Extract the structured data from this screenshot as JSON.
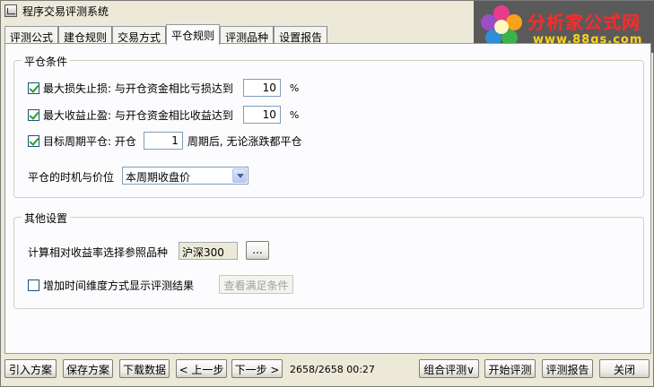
{
  "window": {
    "title": "程序交易评测系统"
  },
  "logo": {
    "title": "分析家公式网",
    "url": "www.88gs.com"
  },
  "tabs": [
    {
      "label": "评测公式",
      "active": false
    },
    {
      "label": "建仓规则",
      "active": false
    },
    {
      "label": "交易方式",
      "active": false
    },
    {
      "label": "平仓规则",
      "active": true
    },
    {
      "label": "评测品种",
      "active": false
    },
    {
      "label": "设置报告",
      "active": false
    }
  ],
  "close_conditions": {
    "legend": "平仓条件",
    "stop_loss": {
      "checked": true,
      "label": "最大损失止损: 与开仓资金相比亏损达到",
      "value": "10",
      "unit": "%"
    },
    "take_profit": {
      "checked": true,
      "label": "最大收益止盈: 与开仓资金相比收益达到",
      "value": "10",
      "unit": "%"
    },
    "target_period": {
      "checked": true,
      "label_before": "目标周期平仓: 开仓",
      "value": "1",
      "label_after": "周期后, 无论涨跌都平仓"
    },
    "timing": {
      "label": "平仓的时机与价位",
      "selected": "本周期收盘价"
    }
  },
  "other_settings": {
    "legend": "其他设置",
    "benchmark": {
      "label": "计算相对收益率选择参照品种",
      "value": "沪深300",
      "browse_label": "..."
    },
    "time_dimension": {
      "checked": false,
      "label": "增加时间维度方式显示评测结果",
      "button_label": "查看满足条件"
    }
  },
  "bottom": {
    "import_label": "引入方案",
    "save_label": "保存方案",
    "download_label": "下载数据",
    "prev_label": "< 上一步",
    "next_label": "下一步 >",
    "status": "2658/2658 00:27",
    "combo_label": "组合评测∨",
    "start_label": "开始评测",
    "report_label": "评测报告",
    "close_label": "关闭"
  }
}
